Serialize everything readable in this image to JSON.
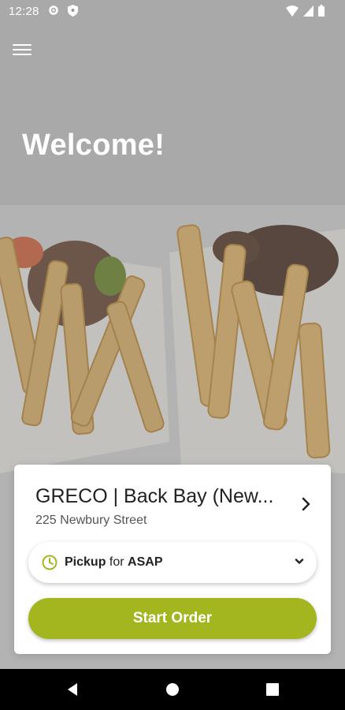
{
  "status_bar": {
    "time": "12:28",
    "left_icons": [
      "gear-icon",
      "shield-icon"
    ],
    "right_icons": [
      "wifi-icon",
      "cell-signal-icon",
      "battery-icon"
    ]
  },
  "header": {
    "menu_icon": "hamburger-menu-icon"
  },
  "hero": {
    "headline": "Welcome!"
  },
  "store_card": {
    "name": "GRECO | Back Bay (New...",
    "address": "225 Newbury Street",
    "pickup": {
      "mode": "Pickup",
      "connector": "for",
      "time": "ASAP"
    },
    "start_button": "Start Order"
  },
  "colors": {
    "accent": "#a3b61f",
    "card_bg": "#ffffff",
    "nav_bg": "#000000"
  },
  "nav_bar": {
    "icons": [
      "back-icon",
      "home-icon",
      "recents-icon"
    ]
  }
}
